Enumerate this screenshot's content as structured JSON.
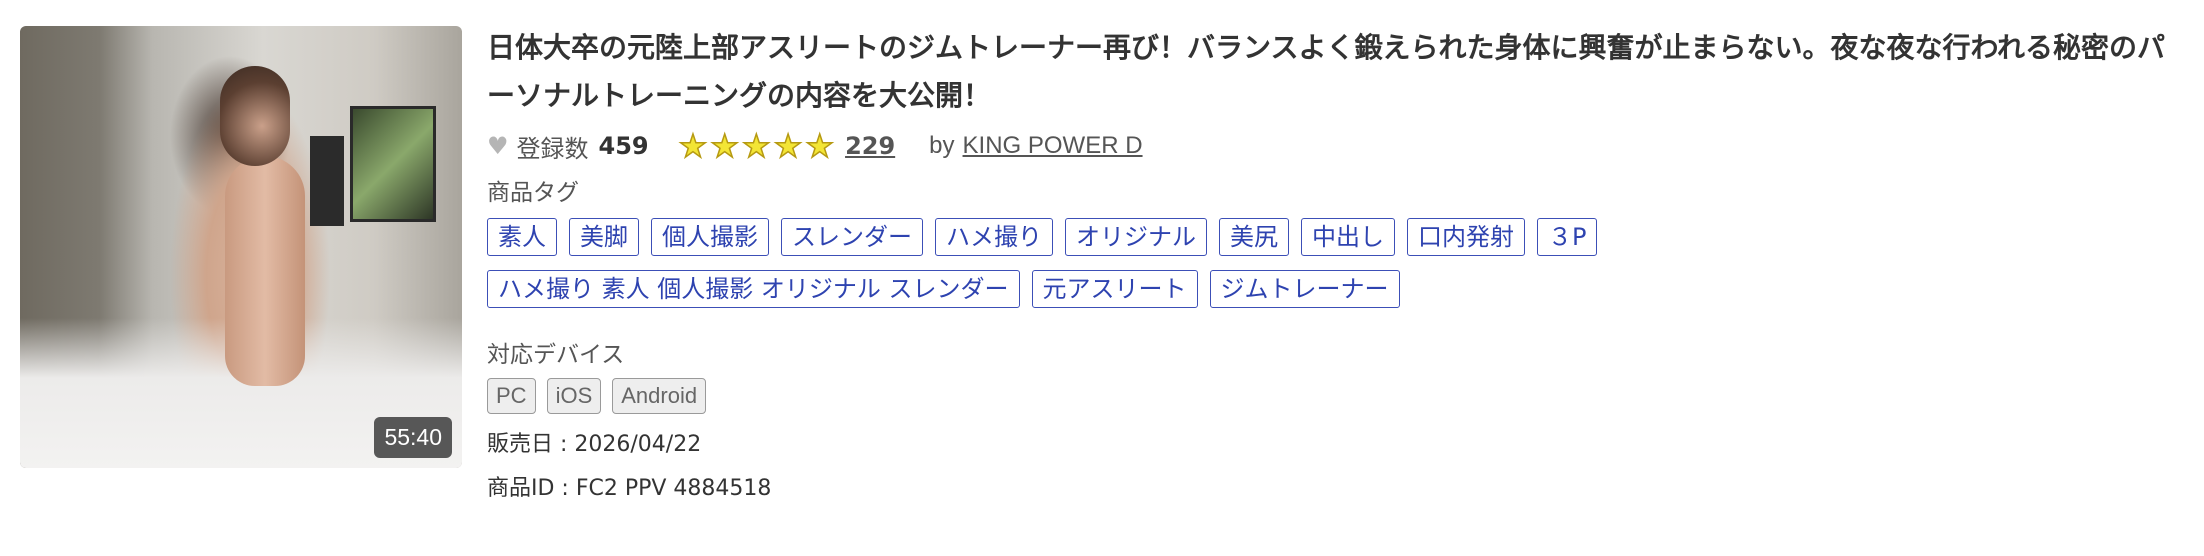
{
  "product": {
    "title": "日体大卒の元陸上部アスリートのジムトレーナー再び！バランスよく鍛えられた身体に興奮が止まらない。夜な夜な行われる秘密のパーソナルトレーニングの内容を大公開！",
    "duration": "55:40",
    "favorites_label": "登録数",
    "favorites_count": "459",
    "rating_stars": 5,
    "review_count": "229",
    "by_label": "by",
    "seller": "KING POWER D"
  },
  "tags": {
    "label": "商品タグ",
    "items": [
      "素人",
      "美脚",
      "個人撮影",
      "スレンダー",
      "ハメ撮り",
      "オリジナル",
      "美尻",
      "中出し",
      "口内発射",
      "３P",
      "ハメ撮り 素人 個人撮影 オリジナル スレンダー",
      "元アスリート",
      "ジムトレーナー"
    ]
  },
  "devices": {
    "label": "対応デバイス",
    "items": [
      "PC",
      "iOS",
      "Android"
    ]
  },
  "info": {
    "release": "販売日 : 2026/04/22",
    "product_id": "商品ID : FC2 PPV 4884518"
  },
  "colors": {
    "tag_border": "#3c4fb7",
    "star_fill": "#f3e535"
  },
  "icons": {
    "heart": "heart-icon",
    "star": "star-icon"
  }
}
